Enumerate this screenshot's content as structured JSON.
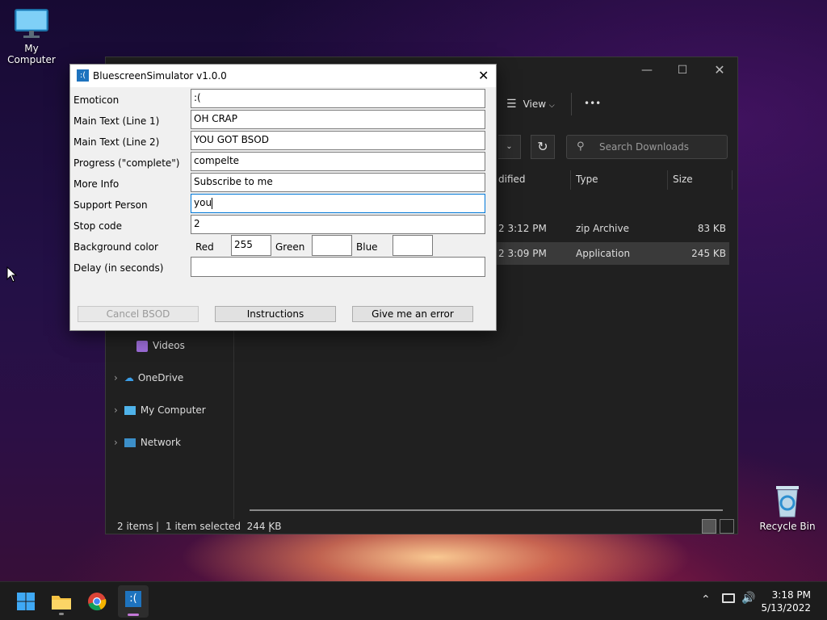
{
  "desktop": {
    "my_computer_label": "My Computer",
    "recycle_bin_label": "Recycle Bin"
  },
  "explorer": {
    "toolbar": {
      "view_label": "View",
      "more_label": "•••"
    },
    "search_placeholder": "Search Downloads",
    "columns": {
      "modified": "dified",
      "type": "Type",
      "size": "Size"
    },
    "rows": [
      {
        "modified": "2 3:12 PM",
        "type": "zip Archive",
        "size": "83 KB"
      },
      {
        "modified": "2 3:09 PM",
        "type": "Application",
        "size": "245 KB"
      }
    ],
    "nav": {
      "videos": "Videos",
      "onedrive": "OneDrive",
      "mycomputer": "My Computer",
      "network": "Network"
    },
    "status": {
      "items": "2 items",
      "selected": "1 item selected  244 KB"
    }
  },
  "dialog": {
    "title": "BluescreenSimulator v1.0.0",
    "labels": {
      "emoticon": "Emoticon",
      "main1": "Main Text (Line 1)",
      "main2": "Main Text (Line 2)",
      "progress": "Progress (\"complete\")",
      "more_info": "More Info",
      "support": "Support Person",
      "stop_code": "Stop code",
      "bg_color": "Background color",
      "delay": "Delay (in seconds)",
      "red": "Red",
      "green": "Green",
      "blue": "Blue"
    },
    "values": {
      "emoticon": ":(",
      "main1": "OH CRAP",
      "main2": "YOU GOT BSOD",
      "progress": "compelte",
      "more_info": "Subscribe to me",
      "support": "you",
      "stop_code": "2",
      "red": "255",
      "green": "",
      "blue": "",
      "delay": ""
    },
    "buttons": {
      "cancel": "Cancel BSOD",
      "instructions": "Instructions",
      "error": "Give me an error"
    }
  },
  "taskbar": {
    "time": "3:18 PM",
    "date": "5/13/2022"
  }
}
